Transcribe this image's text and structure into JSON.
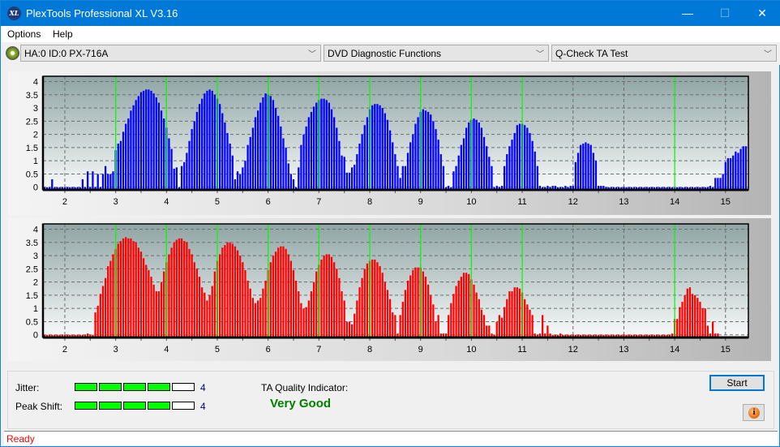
{
  "window": {
    "title": "PlexTools Professional XL V3.16",
    "logo_text": "XL",
    "minimize_glyph": "—",
    "maximize_glyph": "☐",
    "close_glyph": "✕"
  },
  "menu": [
    "Options",
    "Help"
  ],
  "toolbar": {
    "drive": "HA:0 ID:0  PX-716A",
    "function": "DVD Diagnostic Functions",
    "test": "Q-Check TA Test",
    "chevron": "﹀"
  },
  "colors": {
    "top_series": "#0000ff",
    "bottom_series": "#ff0000",
    "reference_lines": "#00ff00",
    "quality_text": "#008000",
    "status_text": "#ff0000",
    "meter_on": "#00ff00"
  },
  "chart_data": [
    {
      "type": "bar",
      "name": "top-chart",
      "title": "",
      "xlabel": "",
      "ylabel": "",
      "xlim": [
        1.57,
        15.45
      ],
      "ylim": [
        -0.1,
        4.2
      ],
      "xticks": [
        2,
        3,
        4,
        5,
        6,
        7,
        8,
        9,
        10,
        11,
        12,
        13,
        14,
        15
      ],
      "yticks": [
        0,
        0.5,
        1,
        1.5,
        2,
        2.5,
        3,
        3.5,
        4
      ],
      "ytick_labels": [
        "0",
        "0.5",
        "1",
        "1.5",
        "2",
        "2.5",
        "3",
        "3.5",
        "4"
      ],
      "reference_lines_x": [
        3,
        4,
        5,
        6,
        7,
        8,
        9,
        10,
        11,
        14
      ],
      "grid": true,
      "x_start": 1.6,
      "x_step": 0.05,
      "values": [
        0,
        0,
        0,
        0.3,
        0,
        0,
        0,
        0,
        0,
        0,
        0,
        0,
        0,
        0,
        0,
        0.3,
        0,
        0.6,
        0,
        0.6,
        0,
        0.5,
        0,
        0.5,
        0.8,
        0.5,
        0.5,
        0.6,
        1.4,
        1.65,
        1.75,
        2.1,
        2.4,
        2.6,
        2.9,
        3.1,
        3.3,
        3.45,
        3.6,
        3.65,
        3.7,
        3.7,
        3.65,
        3.55,
        3.4,
        3.2,
        2.9,
        2.6,
        2.25,
        1.85,
        1.45,
        0.7,
        0.75,
        0,
        0.8,
        0.95,
        1.3,
        1.75,
        2.2,
        2.5,
        2.85,
        3.15,
        3.35,
        3.55,
        3.65,
        3.7,
        3.65,
        3.5,
        3.35,
        3.15,
        2.8,
        2.45,
        2.05,
        1.65,
        1.2,
        0.3,
        0.6,
        0.5,
        0.75,
        1.0,
        1.6,
        1.9,
        2.25,
        2.65,
        2.9,
        3.2,
        3.4,
        3.55,
        3.5,
        3.45,
        3.3,
        3.0,
        2.7,
        2.3,
        1.85,
        1.5,
        0.9,
        0.5,
        0.3,
        0,
        0.75,
        1.6,
        2.0,
        2.3,
        2.65,
        2.85,
        3.05,
        3.2,
        3.3,
        3.35,
        3.35,
        3.3,
        3.2,
        2.95,
        2.65,
        2.25,
        1.75,
        1.2,
        1.15,
        0.55,
        0.55,
        0.75,
        0.85,
        1.25,
        1.65,
        2.0,
        2.35,
        2.65,
        2.95,
        3.1,
        3.15,
        3.15,
        3.1,
        3.0,
        2.8,
        2.55,
        2.15,
        1.7,
        1.25,
        0.8,
        0.35,
        0.8,
        0.8,
        1.3,
        1.7,
        2.0,
        2.4,
        2.65,
        2.85,
        2.95,
        2.9,
        2.85,
        2.75,
        2.5,
        2.2,
        1.8,
        1.25,
        0.8,
        0,
        0.05,
        0,
        0.6,
        0.8,
        1.2,
        1.6,
        1.85,
        2.25,
        2.45,
        2.55,
        2.6,
        2.55,
        2.45,
        2.25,
        1.9,
        1.55,
        1.15,
        0.8,
        0,
        0.05,
        0,
        0.05,
        0.8,
        1.25,
        1.55,
        1.8,
        2.05,
        2.35,
        2.4,
        2.4,
        2.35,
        2.25,
        2.05,
        1.75,
        1.35,
        0.8,
        0.05,
        0,
        0,
        0.05,
        0,
        0.05,
        0.05,
        0,
        0,
        0,
        0.05,
        0,
        0.05,
        0.05,
        0.95,
        1.3,
        1.6,
        1.65,
        1.7,
        1.65,
        1.6,
        1.3,
        1.0,
        0.05,
        0.05,
        0.05,
        0,
        0,
        0,
        0,
        0,
        0,
        0,
        0,
        0,
        0,
        0,
        0,
        0,
        0,
        0,
        0,
        0,
        0,
        0,
        0,
        0,
        0,
        0,
        0,
        0,
        0,
        0,
        0,
        0,
        0,
        0,
        0,
        0,
        0,
        0,
        0,
        0,
        0,
        0,
        0,
        0,
        0.05,
        0,
        0.35,
        0.35,
        0.35,
        0.5,
        0.95,
        1.1,
        1.1,
        1.2,
        1.35,
        1.3,
        1.45,
        1.55,
        1.55,
        1.6,
        1.45,
        1.25,
        1.0,
        0.5,
        0.35,
        0.05
      ]
    },
    {
      "type": "bar",
      "name": "bottom-chart",
      "title": "",
      "xlabel": "",
      "ylabel": "",
      "xlim": [
        1.57,
        15.45
      ],
      "ylim": [
        -0.1,
        4.2
      ],
      "xticks": [
        2,
        3,
        4,
        5,
        6,
        7,
        8,
        9,
        10,
        11,
        12,
        13,
        14,
        15
      ],
      "yticks": [
        0,
        0.5,
        1,
        1.5,
        2,
        2.5,
        3,
        3.5,
        4
      ],
      "ytick_labels": [
        "0",
        "0.5",
        "1",
        "1.5",
        "2",
        "2.5",
        "3",
        "3.5",
        "4"
      ],
      "reference_lines_x": [
        3,
        4,
        5,
        6,
        7,
        8,
        9,
        10,
        11,
        14
      ],
      "grid": true,
      "x_start": 1.6,
      "x_step": 0.05,
      "values": [
        0,
        0,
        0,
        0,
        0,
        0,
        0,
        0,
        0,
        0,
        0,
        0,
        0,
        0,
        0,
        0,
        0,
        0.05,
        0,
        0,
        0.85,
        1.1,
        1.55,
        1.85,
        2.15,
        2.6,
        2.8,
        3.05,
        3.25,
        3.45,
        3.55,
        3.65,
        3.7,
        3.65,
        3.65,
        3.55,
        3.5,
        3.3,
        3.15,
        2.9,
        2.65,
        2.45,
        2.2,
        1.9,
        1.65,
        1.65,
        2.0,
        2.4,
        2.75,
        3.05,
        3.3,
        3.5,
        3.6,
        3.65,
        3.65,
        3.55,
        3.5,
        3.25,
        3.05,
        2.75,
        2.5,
        2.2,
        1.8,
        1.6,
        1.3,
        1.5,
        1.85,
        2.4,
        2.8,
        3.05,
        3.3,
        3.4,
        3.5,
        3.5,
        3.45,
        3.35,
        3.2,
        3.0,
        2.75,
        2.45,
        2.05,
        1.75,
        1.4,
        1.2,
        1.3,
        1.4,
        1.75,
        2.05,
        2.45,
        2.75,
        3.0,
        3.15,
        3.3,
        3.35,
        3.35,
        3.25,
        3.05,
        2.8,
        2.45,
        2.05,
        1.65,
        1.2,
        1.0,
        1.05,
        1.3,
        1.65,
        2.0,
        2.4,
        2.65,
        2.85,
        3.0,
        3.05,
        3.05,
        2.95,
        2.75,
        2.5,
        2.15,
        1.65,
        1.3,
        0.5,
        0.5,
        0.4,
        0.8,
        1.3,
        1.8,
        2.15,
        2.5,
        2.7,
        2.8,
        2.85,
        2.85,
        2.75,
        2.6,
        2.35,
        2.0,
        1.7,
        1.35,
        0.85,
        0.75,
        0.05,
        0.75,
        1.25,
        1.7,
        2.05,
        2.25,
        2.45,
        2.55,
        2.55,
        2.55,
        2.4,
        2.2,
        1.9,
        1.5,
        1.15,
        0.5,
        0.75,
        0.05,
        0.05,
        0.05,
        0.75,
        1.2,
        1.55,
        1.85,
        2.05,
        2.2,
        2.35,
        2.35,
        2.3,
        2.1,
        1.9,
        1.6,
        1.35,
        0.95,
        0.75,
        0.35,
        0.35,
        0.05,
        0,
        0.5,
        0.75,
        0.65,
        1.05,
        1.35,
        1.65,
        1.65,
        1.8,
        1.8,
        1.75,
        1.6,
        1.35,
        1.15,
        0.95,
        0.75,
        0.05,
        0,
        0.05,
        0.75,
        0.05,
        0.35,
        0.05,
        0,
        0,
        0,
        0.05,
        0,
        0,
        0,
        0,
        0,
        0,
        0,
        0,
        0,
        0,
        0,
        0,
        0,
        0,
        0,
        0,
        0,
        0,
        0,
        0,
        0,
        0,
        0,
        0,
        0,
        0,
        0,
        0,
        0,
        0,
        0,
        0,
        0,
        0,
        0,
        0,
        0,
        0,
        0,
        0,
        0,
        0,
        0,
        0.05,
        0.6,
        0.6,
        1.05,
        1.25,
        1.5,
        1.75,
        1.8,
        1.55,
        1.5,
        1.4,
        1.25,
        1.0,
        1.0,
        0.35,
        0.05,
        0.5,
        0.05,
        0.05
      ]
    }
  ],
  "x_tick_labels": [
    "2",
    "3",
    "4",
    "5",
    "6",
    "7",
    "8",
    "9",
    "10",
    "11",
    "12",
    "13",
    "14",
    "15"
  ],
  "results": {
    "jitter_label": "Jitter:",
    "jitter_value": "4",
    "jitter_level": 4,
    "jitter_max": 5,
    "peakshift_label": "Peak Shift:",
    "peakshift_value": "4",
    "peakshift_level": 4,
    "peakshift_max": 5,
    "quality_label": "TA Quality Indicator:",
    "quality_value": "Very Good"
  },
  "buttons": {
    "start": "Start",
    "info_glyph": "i"
  },
  "status": "Ready"
}
